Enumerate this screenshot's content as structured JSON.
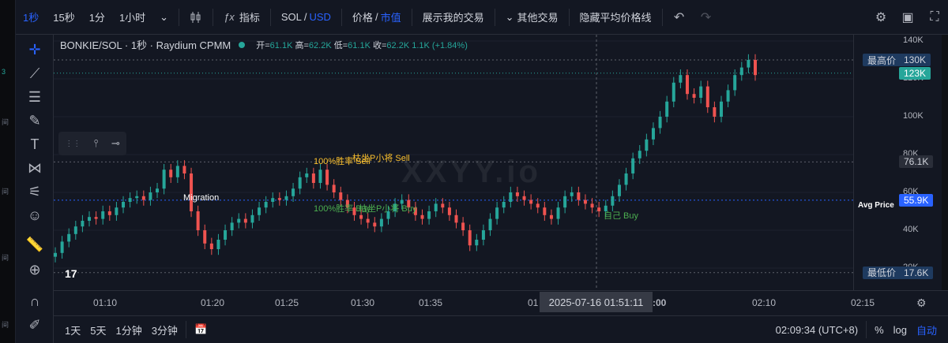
{
  "topbar": {
    "intervals": [
      "1秒",
      "15秒",
      "1分",
      "1小时"
    ],
    "indicators_label": "指标",
    "pair_sol": "SOL",
    "pair_sep": "/",
    "pair_usd": "USD",
    "price_label": "价格",
    "market_cap_label": "市值",
    "show_trades_label": "展示我的交易",
    "other_trades_label": "其他交易",
    "hide_avg_label": "隐藏平均价格线"
  },
  "legend": {
    "title": "BONKIE/SOL · 1秒 · Raydium CPMM",
    "open_label": "开",
    "open": "61.1K",
    "high_label": "高",
    "high": "62.2K",
    "low_label": "低",
    "low": "61.1K",
    "close_label": "收",
    "close": "62.2K",
    "change": "1.1K (+1.84%)"
  },
  "left_strip_labels": [
    "3",
    "间",
    "间",
    "间",
    "间"
  ],
  "watermark": "XXYY.io",
  "chart_data": {
    "type": "candlestick",
    "y_ticks": [
      "140K",
      "120K",
      "100K",
      "80K",
      "60K",
      "40K",
      "20K"
    ],
    "y_tick_values": [
      140,
      120,
      100,
      80,
      60,
      40,
      20
    ],
    "x_ticks": [
      "01:10",
      "01:20",
      "01:25",
      "01:30",
      "01:35",
      "01",
      ":00",
      "02:10",
      "02:15"
    ],
    "series_k": [
      28,
      34,
      38,
      42,
      45,
      47,
      46,
      50,
      48,
      52,
      55,
      57,
      58,
      56,
      60,
      62,
      72,
      68,
      74,
      70,
      50,
      40,
      33,
      30,
      35,
      40,
      44,
      46,
      44,
      48,
      52,
      55,
      57,
      56,
      58,
      62,
      68,
      70,
      65,
      72,
      64,
      60,
      56,
      52,
      48,
      46,
      44,
      42,
      46,
      50,
      54,
      56,
      52,
      48,
      46,
      50,
      54,
      52,
      48,
      44,
      40,
      32,
      35,
      40,
      46,
      52,
      55,
      60,
      58,
      56,
      54,
      52,
      48,
      46,
      52,
      58,
      60,
      56,
      54,
      52,
      50,
      53,
      58,
      64,
      70,
      78,
      82,
      88,
      94,
      100,
      108,
      118,
      122,
      112,
      110,
      116,
      105,
      100,
      108,
      114,
      122,
      126,
      130,
      122
    ],
    "annotations": [
      {
        "text": "Migration",
        "kind": "event"
      },
      {
        "text": "100%胜率 Sell",
        "kind": "sell"
      },
      {
        "text": "枯坐P小将 Sell",
        "kind": "sell"
      },
      {
        "text": "100%胜率 Buy",
        "kind": "buy"
      },
      {
        "text": "枯坐P小将 Buy",
        "kind": "buy"
      },
      {
        "text": "自己 Buy",
        "kind": "buy"
      }
    ],
    "price_lines": {
      "high_label": "最高价",
      "high_value": "130K",
      "high_k": 130,
      "current_value": "123K",
      "current_k": 123,
      "mid_value": "76.1K",
      "mid_k": 76.1,
      "avg_label": "Avg Price",
      "avg_value": "55.9K",
      "avg_k": 55.9,
      "low_label": "最低价",
      "low_value": "17.6K",
      "low_k": 17.6
    },
    "crosshair_date": "2025-07-16   01:51:11"
  },
  "bottombar": {
    "ranges": [
      "1天",
      "5天",
      "1分钟",
      "3分钟"
    ],
    "clock": "02:09:34 (UTC+8)",
    "percent_label": "%",
    "log_label": "log",
    "auto_label": "自动"
  },
  "colors": {
    "up": "#26a69a",
    "down": "#ef5350",
    "accent": "#2962ff",
    "buy": "#4caf50",
    "sell": "#fbc02d"
  }
}
